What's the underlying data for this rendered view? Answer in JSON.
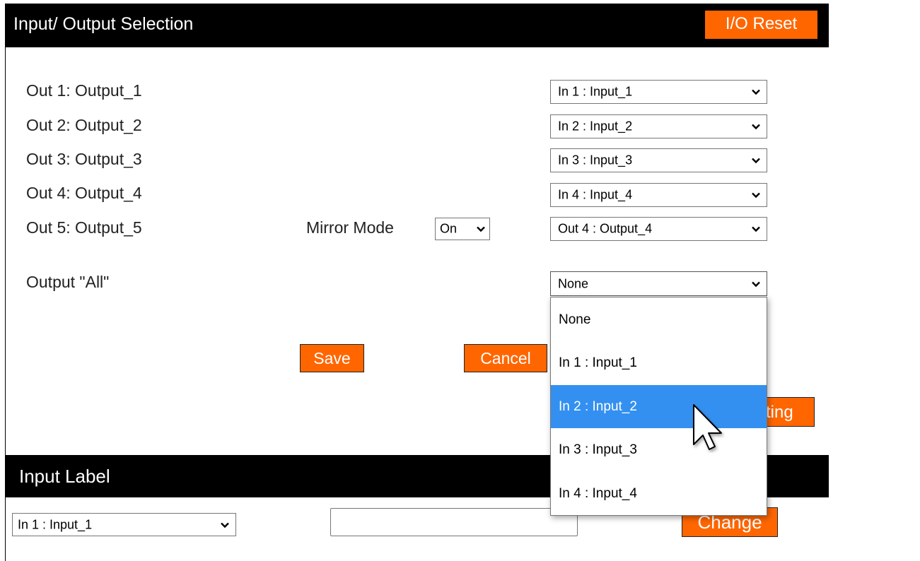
{
  "io_section": {
    "title": "Input/ Output Selection",
    "reset_label": "I/O Reset",
    "outputs": [
      {
        "label": "Out 1: Output_1",
        "selected": "In 1 : Input_1"
      },
      {
        "label": "Out 2: Output_2",
        "selected": "In 2 : Input_2"
      },
      {
        "label": "Out 3: Output_3",
        "selected": "In 3 : Input_3"
      },
      {
        "label": "Out 4: Output_4",
        "selected": "In 4 : Input_4"
      },
      {
        "label": "Out 5: Output_5",
        "selected": "Out 4 : Output_4"
      }
    ],
    "mirror_mode": {
      "label": "Mirror Mode",
      "value": "On"
    },
    "output_all": {
      "label": "Output \"All\"",
      "selected": "None",
      "options": [
        "None",
        "In 1 : Input_1",
        "In 2 : Input_2",
        "In 3 : Input_3",
        "In 4 : Input_4"
      ],
      "highlighted": "In 2 : Input_2"
    },
    "save_label": "Save",
    "cancel_label": "Cancel",
    "partial_button_label": "ting"
  },
  "input_label_section": {
    "title": "Input Label",
    "selected_input": "In 1 : Input_1",
    "name_value": "",
    "change_label": "Change"
  },
  "colors": {
    "accent": "#ff6600",
    "header_bg": "#000000",
    "highlight": "#3390f0"
  },
  "icons": {
    "dropdown": "chevron-down-icon",
    "pointer": "mouse-pointer-icon"
  }
}
